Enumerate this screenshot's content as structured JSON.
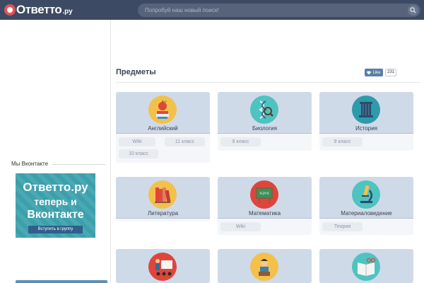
{
  "header": {
    "logo_text": "Ответто",
    "logo_tld": ".ру",
    "search_placeholder": "Попробуй наш новый поиск!"
  },
  "sidebar": {
    "vk_title": "Мы Вконтакте",
    "banner": {
      "line1": "Ответто.ру",
      "line2": "теперь и",
      "line3": "Вконтакте",
      "join_label": "Вступить в группу"
    }
  },
  "main": {
    "title": "Предметы",
    "like_label": "Like",
    "like_count": "231",
    "subjects": [
      {
        "name": "Английский",
        "icon": "apple-books-icon",
        "tags": [
          "Wiki",
          "11 класс",
          "10 класс"
        ]
      },
      {
        "name": "Биология",
        "icon": "dna-magnifier-icon",
        "tags": [
          "9 класс"
        ]
      },
      {
        "name": "История",
        "icon": "column-icon",
        "tags": [
          "9 класс"
        ]
      },
      {
        "name": "Литература",
        "icon": "books-icon",
        "tags": []
      },
      {
        "name": "Математика",
        "icon": "blackboard-icon",
        "tags": [
          "Wiki"
        ]
      },
      {
        "name": "Материаловедение",
        "icon": "microscope-icon",
        "tags": [
          "Теория"
        ]
      },
      {
        "name": "",
        "icon": "presenter-icon",
        "tags": []
      },
      {
        "name": "",
        "icon": "teacher-icon",
        "tags": []
      },
      {
        "name": "",
        "icon": "open-book-icon",
        "tags": []
      }
    ]
  },
  "colors": {
    "header_bg": "#3c4a63",
    "card_top": "#cfdae9",
    "accent": "#5b7fa6"
  }
}
